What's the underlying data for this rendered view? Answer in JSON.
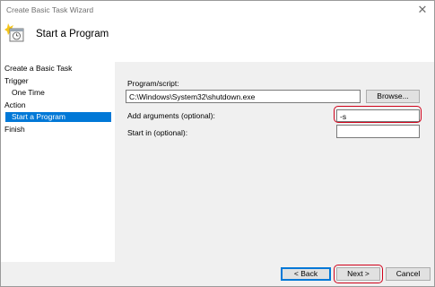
{
  "window": {
    "title": "Create Basic Task Wizard",
    "close_glyph": "✕"
  },
  "header": {
    "title": "Start a Program",
    "icon": "task-scheduler-icon"
  },
  "sidebar": {
    "items": [
      {
        "label": "Create a Basic Task"
      },
      {
        "label": "Trigger"
      },
      {
        "label": "One Time"
      },
      {
        "label": "Action"
      },
      {
        "label": "Start a Program",
        "selected": true
      },
      {
        "label": "Finish"
      }
    ]
  },
  "form": {
    "program_label": "Program/script:",
    "program_value": "C:\\Windows\\System32\\shutdown.exe",
    "browse_label": "Browse...",
    "args_label": "Add arguments (optional):",
    "args_value": "-s",
    "startin_label": "Start in (optional):",
    "startin_value": ""
  },
  "buttons": {
    "back": "< Back",
    "next": "Next >",
    "cancel": "Cancel"
  },
  "colors": {
    "selection": "#0078d7",
    "annotation": "#d0021b",
    "panel": "#f0f0f0"
  }
}
